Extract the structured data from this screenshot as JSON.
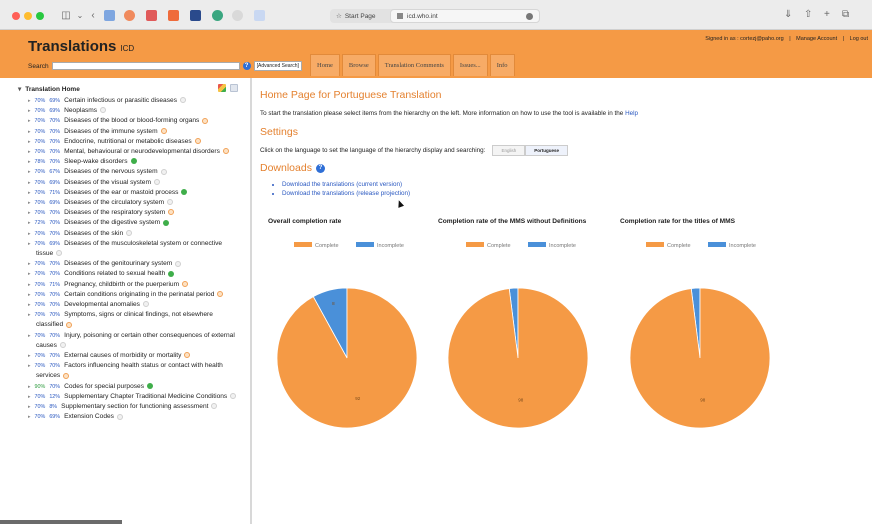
{
  "browser": {
    "tab_start": "Start Page",
    "tab_active": "icd.who.int"
  },
  "app": {
    "title": "Translations",
    "subtitle": "ICD",
    "user_bar": {
      "signed_in": "Signed in as : cortezj@paho.org",
      "manage": "Manage Account",
      "logout": "Log out"
    },
    "search_label": "Search",
    "advanced_search": "Advanced Search",
    "nav_tabs": [
      "Home",
      "Browse",
      "Translation Comments",
      "Issues...",
      "Info"
    ]
  },
  "sidebar": {
    "title": "Translation Home",
    "items": [
      {
        "p1": "70%",
        "p2": "69%",
        "label": "Certain infectious or parasitic diseases",
        "status": "grey"
      },
      {
        "p1": "70%",
        "p2": "69%",
        "label": "Neoplasms",
        "status": "grey"
      },
      {
        "p1": "70%",
        "p2": "70%",
        "label": "Diseases of the blood or blood-forming organs",
        "status": "orange"
      },
      {
        "p1": "70%",
        "p2": "70%",
        "label": "Diseases of the immune system",
        "status": "orange"
      },
      {
        "p1": "70%",
        "p2": "70%",
        "label": "Endocrine, nutritional or metabolic diseases",
        "status": "orange"
      },
      {
        "p1": "70%",
        "p2": "70%",
        "label": "Mental, behavioural or neurodevelopmental disorders",
        "status": "orange"
      },
      {
        "p1": "78%",
        "p2": "70%",
        "label": "Sleep-wake disorders",
        "status": "green"
      },
      {
        "p1": "70%",
        "p2": "67%",
        "label": "Diseases of the nervous system",
        "status": "grey"
      },
      {
        "p1": "70%",
        "p2": "69%",
        "label": "Diseases of the visual system",
        "status": "grey"
      },
      {
        "p1": "70%",
        "p2": "71%",
        "label": "Diseases of the ear or mastoid process",
        "status": "green"
      },
      {
        "p1": "70%",
        "p2": "69%",
        "label": "Diseases of the circulatory system",
        "status": "grey"
      },
      {
        "p1": "70%",
        "p2": "70%",
        "label": "Diseases of the respiratory system",
        "status": "orange"
      },
      {
        "p1": "72%",
        "p2": "70%",
        "label": "Diseases of the digestive system",
        "status": "green"
      },
      {
        "p1": "70%",
        "p2": "70%",
        "label": "Diseases of the skin",
        "status": "grey"
      },
      {
        "p1": "70%",
        "p2": "69%",
        "label": "Diseases of the musculoskeletal system or connective tissue",
        "status": "grey"
      },
      {
        "p1": "70%",
        "p2": "70%",
        "label": "Diseases of the genitourinary system",
        "status": "grey"
      },
      {
        "p1": "70%",
        "p2": "70%",
        "label": "Conditions related to sexual health",
        "status": "green"
      },
      {
        "p1": "70%",
        "p2": "71%",
        "label": "Pregnancy, childbirth or the puerperium",
        "status": "orange"
      },
      {
        "p1": "70%",
        "p2": "70%",
        "label": "Certain conditions originating in the perinatal period",
        "status": "orange"
      },
      {
        "p1": "70%",
        "p2": "70%",
        "label": "Developmental anomalies",
        "status": "grey"
      },
      {
        "p1": "70%",
        "p2": "70%",
        "label": "Symptoms, signs or clinical findings, not elsewhere classified",
        "status": "orange"
      },
      {
        "p1": "70%",
        "p2": "70%",
        "label": "Injury, poisoning or certain other consequences of external causes",
        "status": "grey"
      },
      {
        "p1": "70%",
        "p2": "70%",
        "label": "External causes of morbidity or mortality",
        "status": "orange"
      },
      {
        "p1": "70%",
        "p2": "70%",
        "label": "Factors influencing health status or contact with health services",
        "status": "orange"
      },
      {
        "p1": "90%",
        "p2": "70%",
        "label": "Codes for special purposes",
        "status": "green",
        "p1_green": true
      },
      {
        "p1": "70%",
        "p2": "12%",
        "label": "Supplementary Chapter Traditional Medicine Conditions",
        "status": "grey"
      },
      {
        "p1": "70%",
        "p2": "8%",
        "label": "Supplementary section for functioning assessment",
        "status": "grey"
      },
      {
        "p1": "70%",
        "p2": "69%",
        "label": "Extension Codes",
        "status": "grey"
      }
    ]
  },
  "main": {
    "title": "Home Page for Portuguese Translation",
    "intro": "To start the translation please select items from the hierarchy on the left. More information on how to use the tool is available in the",
    "intro_link": "Help",
    "settings_title": "Settings",
    "lang_text": "Click on the language to set the language of the hierarchy display and searching:",
    "lang_options": [
      "English",
      "Portuguese"
    ],
    "downloads_title": "Downloads",
    "downloads": [
      "Download the translations (current version)",
      "Download the translations (release projection)"
    ]
  },
  "colors": {
    "complete": "#f59a45",
    "incomplete": "#4a90d9",
    "header": "#f59a45"
  },
  "chart_data": [
    {
      "type": "pie",
      "title": "Overall completion rate",
      "categories": [
        "Complete",
        "Incomplete"
      ],
      "values": [
        92,
        8
      ],
      "labels": [
        "92",
        "8"
      ]
    },
    {
      "type": "pie",
      "title": "Completion rate of the MMS without Definitions",
      "categories": [
        "Complete",
        "Incomplete"
      ],
      "values": [
        98,
        2
      ],
      "labels": [
        "98",
        ""
      ]
    },
    {
      "type": "pie",
      "title": "Completion rate for the titles of MMS",
      "categories": [
        "Complete",
        "Incomplete"
      ],
      "values": [
        98,
        2
      ],
      "labels": [
        "98",
        ""
      ]
    }
  ]
}
